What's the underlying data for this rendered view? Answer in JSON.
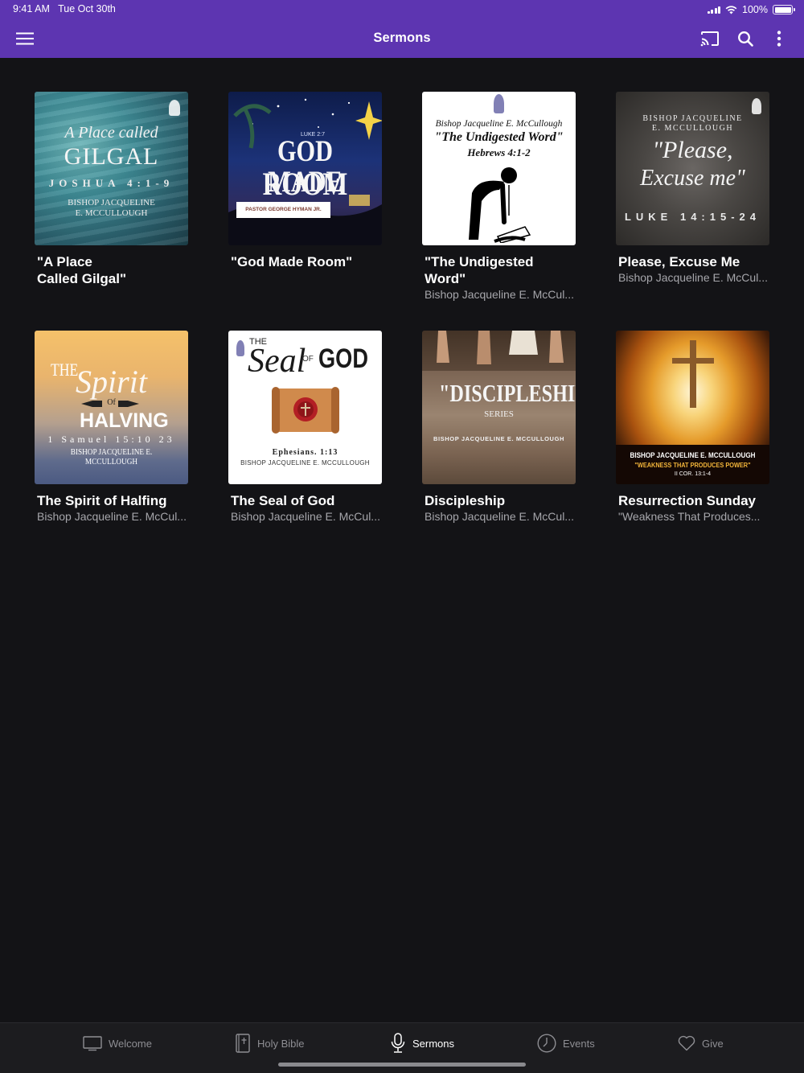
{
  "status_bar": {
    "time": "9:41 AM",
    "date": "Tue Oct 30th",
    "battery_text": "100%",
    "battery_level_percent": 100
  },
  "app_bar": {
    "title": "Sermons",
    "left_icon": "hamburger-menu-icon",
    "right_icons": [
      "cast-icon",
      "search-icon",
      "more-vertical-icon"
    ],
    "background_color": "#5d35b1"
  },
  "sermons": [
    {
      "title": "\"A Place\nCalled Gilgal\"",
      "subtitle": "",
      "art": {
        "line1": "A Place called",
        "line2": "GILGAL",
        "line3": "JOSHUA 4:1-9",
        "line4": "BISHOP JACQUELINE",
        "line5": "E. MCCULLOUGH"
      }
    },
    {
      "title": "\"God Made Room\"",
      "subtitle": "",
      "art": {
        "line1": "LUKE 2:7",
        "line2": "GOD MADE",
        "line3": "ROOM",
        "line4": "PASTOR GEORGE HYMAN JR."
      }
    },
    {
      "title": "\"The Undigested\nWord\"",
      "subtitle": "Bishop Jacqueline E. McCul...",
      "art": {
        "line1": "Bishop Jacqueline E. McCullough",
        "line2": "\"The Undigested Word\"",
        "line3": "Hebrews 4:1-2"
      }
    },
    {
      "title": "Please, Excuse Me",
      "subtitle": "Bishop Jacqueline E. McCul...",
      "art": {
        "line1": "BISHOP JACQUELINE",
        "line2": "E. MCCULLOUGH",
        "line3": "\"Please,",
        "line4": "Excuse me\"",
        "line5": "LUKE 14:15-24"
      }
    },
    {
      "title": "The Spirit of Halfing",
      "subtitle": "Bishop Jacqueline E. McCul...",
      "art": {
        "line1": "THE",
        "line2": "Spirit",
        "line3": "Of",
        "line4": "HALVING",
        "line5": "1 Samuel 15:10 23",
        "line6": "BISHOP JACQUELINE E. MCCULLOUGH"
      }
    },
    {
      "title": "The Seal of God",
      "subtitle": "Bishop Jacqueline E. McCul...",
      "art": {
        "line1": "THE",
        "line2": "Seal",
        "line3": "OF",
        "line4": "GOD",
        "line5": "Ephesians. 1:13",
        "line6": "BISHOP JACQUELINE E. MCCULLOUGH"
      }
    },
    {
      "title": "Discipleship",
      "subtitle": "Bishop Jacqueline E. McCul...",
      "art": {
        "line1": "\"DISCIPLESHIP\"",
        "line2": "SERIES",
        "line3": "BISHOP JACQUELINE E. MCCULLOUGH"
      }
    },
    {
      "title": "Resurrection Sunday",
      "subtitle": "\"Weakness That Produces...",
      "art": {
        "line1": "BISHOP JACQUELINE E. MCCULLOUGH",
        "line2": "\"WEAKNESS THAT PRODUCES POWER\"",
        "line3": "II COR. 13:1-4"
      }
    }
  ],
  "bottom_nav": [
    {
      "label": "Welcome",
      "icon": "tv-icon",
      "active": false
    },
    {
      "label": "Holy Bible",
      "icon": "bible-icon",
      "active": false
    },
    {
      "label": "Sermons",
      "icon": "microphone-icon",
      "active": true
    },
    {
      "label": "Events",
      "icon": "clock-icon",
      "active": false
    },
    {
      "label": "Give",
      "icon": "heart-icon",
      "active": false
    }
  ]
}
